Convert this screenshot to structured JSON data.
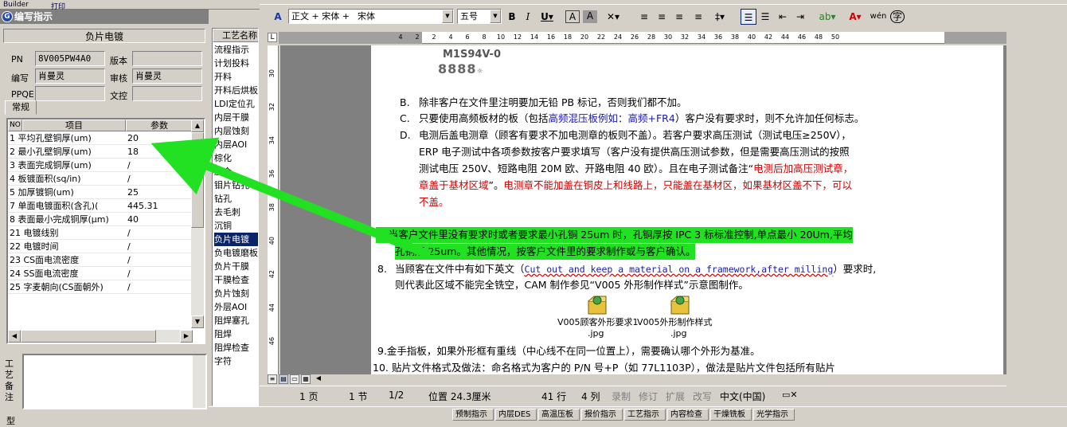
{
  "top_strip": {
    "left_text": "Builder",
    "mid_text": "打印"
  },
  "panel": {
    "title": "编写指示",
    "header": "负片电镀",
    "fields": {
      "pn_label": "PN",
      "pn_value": "8V005PW4A0",
      "version_label": "版本",
      "version_value": "",
      "writer_label": "编写",
      "writer_value": "肖曼灵",
      "reviewer_label": "审核",
      "reviewer_value": "肖曼灵",
      "ppqe_label": "PPQE",
      "ppqe_value": "",
      "control_label": "文控",
      "control_value": ""
    },
    "tab": "常规",
    "table": {
      "headers": [
        "NO",
        "项目",
        "参数"
      ],
      "rows": [
        {
          "no": "1",
          "item": "平均孔壁铜厚(um)",
          "param": "20"
        },
        {
          "no": "2",
          "item": "最小孔壁铜厚(um)",
          "param": "18"
        },
        {
          "no": "3",
          "item": "表面完成铜厚(um)",
          "param": "/"
        },
        {
          "no": "4",
          "item": "板镀面积(sq/in)",
          "param": "/"
        },
        {
          "no": "5",
          "item": "加厚镀铜(um)",
          "param": "25"
        },
        {
          "no": "7",
          "item": "单面电镀面积(含孔)(",
          "param": "445.31"
        },
        {
          "no": "8",
          "item": "表面最小完成铜厚(μm)",
          "param": "40"
        },
        {
          "no": "21",
          "item": "电镀线别",
          "param": "/"
        },
        {
          "no": "22",
          "item": "电镀时间",
          "param": "/"
        },
        {
          "no": "23",
          "item": "CS面电流密度",
          "param": "/"
        },
        {
          "no": "24",
          "item": "SS面电流密度",
          "param": "/"
        },
        {
          "no": "25",
          "item": "字麦朝向(CS面朝外)",
          "param": "/"
        }
      ]
    },
    "note_label": "工艺备注",
    "type_label": "型"
  },
  "process_list": {
    "header": "工艺名称",
    "items": [
      "流程指示",
      "计划投料",
      "开料",
      "开料后烘板",
      "LDI定位孔",
      "内层干膜",
      "内层蚀刻",
      "内层AOI",
      "棕化",
      "压合",
      "钼片钻孔",
      "钻孔",
      "去毛刺",
      "沉铜",
      "负片电镀",
      "负电镀磨板",
      "负片干膜",
      "干膜检查",
      "负片蚀刻",
      "外层AOI",
      "阻焊塞孔",
      "阻焊",
      "阻焊检查",
      "字符"
    ],
    "selected_index": 14
  },
  "word": {
    "style_combo": "正文 + 宋体",
    "font_combo": "宋体",
    "size_combo": "五号",
    "ruler_numbers": [
      "4",
      "2",
      "2",
      "4",
      "6",
      "8",
      "10",
      "12",
      "14",
      "16",
      "18",
      "20",
      "22",
      "24",
      "26",
      "28",
      "30",
      "32",
      "34",
      "36",
      "38",
      "40",
      "42",
      "44",
      "46",
      "48",
      "50"
    ],
    "vruler_numbers": [
      "30",
      "32",
      "34",
      "36",
      "38",
      "40",
      "42",
      "44",
      "46"
    ],
    "doc": {
      "logo_line1": "M1S94V-0",
      "logo_line2": "8888",
      "b_label": "B.",
      "b_text": "除非客户在文件里注明要加无铅 PB 标记，否则我们都不加。",
      "c_label": "C.",
      "c_text1": "只要使用高频板材的板（包括",
      "c_text_blue": "高频混压板例如：高频+FR4",
      "c_text2": "）客户没有要求时，则不允许加任何标志。",
      "d_label": "D.",
      "d_line1": "电测后盖电测章（顾客有要求不加电测章的板则不盖）。若客户要求高压测试（测试电压≥250V），",
      "d_line2": "ERP 电子测试中各项参数按客户要求填写（客户没有提供高压测试参数，但是需要高压测试的按照",
      "d_line3_black": "测试电压 250V、短路电阻 20M 欧、开路电阻 40 欧）。且在电子测试备注“",
      "d_line3_red": "电测后加高压测试章，",
      "d_line4_red1": "章盖于基材区域",
      "d_line4_black": "”。",
      "d_line4_red2": "电测章不能加盖在铜皮上和线路上，只能盖在基材区，如果基材区盖不下，可以",
      "d_line5_red": "不盖。",
      "p7_line1": "7.   当客户文件里没有要求时或者要求最小孔铜 25um 时，孔铜厚按 IPC 3 标标准控制,单点最小 20Um,平均",
      "p7_line2": "孔铜厚 25um。其他情况，按客户文件里的要求制作或与客户确认。",
      "p8_num": "8.",
      "p8_text1": "当顾客在文件中有如下英文（",
      "p8_en": "Cut out and keep a material on a framework,after milling",
      "p8_text2": "）要求时,",
      "p8_line2": "则代表此区域不能完全铣空，CAM 制作参见“V005 外形制作样式”示意图制作。",
      "file1_name": "V005顾客外形要求1",
      "file1_ext": ".jpg",
      "file2_name": "V005外形制作样式",
      "file2_ext": ".jpg",
      "p9": "9.金手指板，如果外形框有重线（中心线不在同一位置上），需要确认哪个外形为基准。",
      "p10": "10.  贴片文件格式及做法：命名格式为客户的 P/N 号+P（如 77L1103P），做法是贴片文件包括所有贴片"
    },
    "status": {
      "page": "1 页",
      "section": "1 节",
      "pages": "1/2",
      "position": "位置 24.3厘米",
      "line": "41 行",
      "col": "4 列",
      "rec": "录制",
      "rev": "修订",
      "ext": "扩展",
      "ovr": "改写",
      "lang": "中文(中国)"
    }
  },
  "taskbar": {
    "items": [
      "预制指示",
      "内层DES",
      "高温压板",
      "报价指示",
      "工艺指示",
      "内容检查",
      "干燥铣板",
      "光学指示"
    ]
  },
  "colors": {
    "highlight": "#22e022",
    "arrow": "#22e022",
    "red_text": "#d00000",
    "blue_text": "#1a1ab0",
    "selection": "#0a246a"
  }
}
